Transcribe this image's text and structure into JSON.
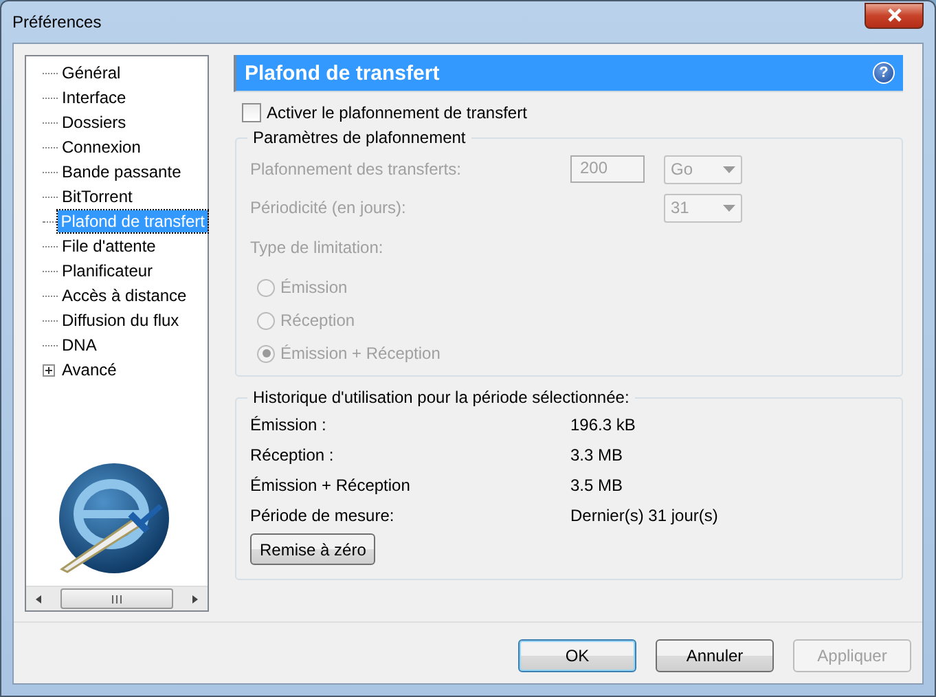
{
  "window": {
    "title": "Préférences"
  },
  "sidebar": {
    "items": [
      {
        "label": "Général",
        "kind": "leaf",
        "selected": false
      },
      {
        "label": "Interface",
        "kind": "leaf",
        "selected": false
      },
      {
        "label": "Dossiers",
        "kind": "leaf",
        "selected": false
      },
      {
        "label": "Connexion",
        "kind": "leaf",
        "selected": false
      },
      {
        "label": "Bande passante",
        "kind": "leaf",
        "selected": false
      },
      {
        "label": "BitTorrent",
        "kind": "leaf",
        "selected": false
      },
      {
        "label": "Plafond de transfert",
        "kind": "leaf",
        "selected": true
      },
      {
        "label": "File d'attente",
        "kind": "leaf",
        "selected": false
      },
      {
        "label": "Planificateur",
        "kind": "leaf",
        "selected": false
      },
      {
        "label": "Accès à distance",
        "kind": "leaf",
        "selected": false
      },
      {
        "label": "Diffusion du flux",
        "kind": "leaf",
        "selected": false
      },
      {
        "label": "DNA",
        "kind": "leaf",
        "selected": false
      },
      {
        "label": "Avancé",
        "kind": "group",
        "expanded": false,
        "selected": false
      }
    ]
  },
  "panel": {
    "title": "Plafond de transfert",
    "help": "?",
    "enable": {
      "label": "Activer le plafonnement de transfert",
      "checked": false
    },
    "settings": {
      "title": "Paramètres de plafonnement",
      "disabled": true,
      "limit_label": "Plafonnement des transferts:",
      "limit_value": "200",
      "limit_unit": "Go",
      "period_label": "Périodicité (en jours):",
      "period_value": "31",
      "type_label": "Type de limitation:",
      "types": [
        {
          "label": "Émission",
          "selected": false
        },
        {
          "label": "Réception",
          "selected": false
        },
        {
          "label": "Émission + Réception",
          "selected": true
        }
      ]
    },
    "history": {
      "title": "Historique d'utilisation pour la période sélectionnée:",
      "rows": [
        {
          "label": "Émission :",
          "value": "196.3 kB"
        },
        {
          "label": "Réception :",
          "value": "3.3 MB"
        },
        {
          "label": "Émission + Réception",
          "value": "3.5 MB"
        },
        {
          "label": "Période de mesure:",
          "value": "Dernier(s) 31 jour(s)"
        }
      ],
      "reset": "Remise à zéro"
    }
  },
  "buttons": [
    {
      "label": "OK",
      "default": true,
      "disabled": false
    },
    {
      "label": "Annuler",
      "default": false,
      "disabled": false
    },
    {
      "label": "Appliquer",
      "default": false,
      "disabled": true
    }
  ]
}
